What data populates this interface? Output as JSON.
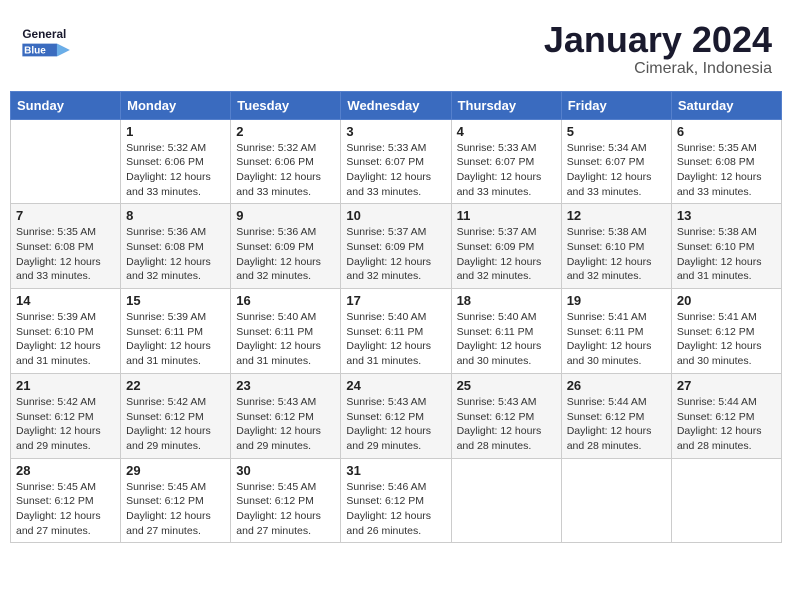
{
  "header": {
    "logo_line1": "General",
    "logo_line2": "Blue",
    "month": "January 2024",
    "location": "Cimerak, Indonesia"
  },
  "weekdays": [
    "Sunday",
    "Monday",
    "Tuesday",
    "Wednesday",
    "Thursday",
    "Friday",
    "Saturday"
  ],
  "weeks": [
    [
      {
        "day": "",
        "info": ""
      },
      {
        "day": "1",
        "info": "Sunrise: 5:32 AM\nSunset: 6:06 PM\nDaylight: 12 hours\nand 33 minutes."
      },
      {
        "day": "2",
        "info": "Sunrise: 5:32 AM\nSunset: 6:06 PM\nDaylight: 12 hours\nand 33 minutes."
      },
      {
        "day": "3",
        "info": "Sunrise: 5:33 AM\nSunset: 6:07 PM\nDaylight: 12 hours\nand 33 minutes."
      },
      {
        "day": "4",
        "info": "Sunrise: 5:33 AM\nSunset: 6:07 PM\nDaylight: 12 hours\nand 33 minutes."
      },
      {
        "day": "5",
        "info": "Sunrise: 5:34 AM\nSunset: 6:07 PM\nDaylight: 12 hours\nand 33 minutes."
      },
      {
        "day": "6",
        "info": "Sunrise: 5:35 AM\nSunset: 6:08 PM\nDaylight: 12 hours\nand 33 minutes."
      }
    ],
    [
      {
        "day": "7",
        "info": "Sunrise: 5:35 AM\nSunset: 6:08 PM\nDaylight: 12 hours\nand 33 minutes."
      },
      {
        "day": "8",
        "info": "Sunrise: 5:36 AM\nSunset: 6:08 PM\nDaylight: 12 hours\nand 32 minutes."
      },
      {
        "day": "9",
        "info": "Sunrise: 5:36 AM\nSunset: 6:09 PM\nDaylight: 12 hours\nand 32 minutes."
      },
      {
        "day": "10",
        "info": "Sunrise: 5:37 AM\nSunset: 6:09 PM\nDaylight: 12 hours\nand 32 minutes."
      },
      {
        "day": "11",
        "info": "Sunrise: 5:37 AM\nSunset: 6:09 PM\nDaylight: 12 hours\nand 32 minutes."
      },
      {
        "day": "12",
        "info": "Sunrise: 5:38 AM\nSunset: 6:10 PM\nDaylight: 12 hours\nand 32 minutes."
      },
      {
        "day": "13",
        "info": "Sunrise: 5:38 AM\nSunset: 6:10 PM\nDaylight: 12 hours\nand 31 minutes."
      }
    ],
    [
      {
        "day": "14",
        "info": "Sunrise: 5:39 AM\nSunset: 6:10 PM\nDaylight: 12 hours\nand 31 minutes."
      },
      {
        "day": "15",
        "info": "Sunrise: 5:39 AM\nSunset: 6:11 PM\nDaylight: 12 hours\nand 31 minutes."
      },
      {
        "day": "16",
        "info": "Sunrise: 5:40 AM\nSunset: 6:11 PM\nDaylight: 12 hours\nand 31 minutes."
      },
      {
        "day": "17",
        "info": "Sunrise: 5:40 AM\nSunset: 6:11 PM\nDaylight: 12 hours\nand 31 minutes."
      },
      {
        "day": "18",
        "info": "Sunrise: 5:40 AM\nSunset: 6:11 PM\nDaylight: 12 hours\nand 30 minutes."
      },
      {
        "day": "19",
        "info": "Sunrise: 5:41 AM\nSunset: 6:11 PM\nDaylight: 12 hours\nand 30 minutes."
      },
      {
        "day": "20",
        "info": "Sunrise: 5:41 AM\nSunset: 6:12 PM\nDaylight: 12 hours\nand 30 minutes."
      }
    ],
    [
      {
        "day": "21",
        "info": "Sunrise: 5:42 AM\nSunset: 6:12 PM\nDaylight: 12 hours\nand 29 minutes."
      },
      {
        "day": "22",
        "info": "Sunrise: 5:42 AM\nSunset: 6:12 PM\nDaylight: 12 hours\nand 29 minutes."
      },
      {
        "day": "23",
        "info": "Sunrise: 5:43 AM\nSunset: 6:12 PM\nDaylight: 12 hours\nand 29 minutes."
      },
      {
        "day": "24",
        "info": "Sunrise: 5:43 AM\nSunset: 6:12 PM\nDaylight: 12 hours\nand 29 minutes."
      },
      {
        "day": "25",
        "info": "Sunrise: 5:43 AM\nSunset: 6:12 PM\nDaylight: 12 hours\nand 28 minutes."
      },
      {
        "day": "26",
        "info": "Sunrise: 5:44 AM\nSunset: 6:12 PM\nDaylight: 12 hours\nand 28 minutes."
      },
      {
        "day": "27",
        "info": "Sunrise: 5:44 AM\nSunset: 6:12 PM\nDaylight: 12 hours\nand 28 minutes."
      }
    ],
    [
      {
        "day": "28",
        "info": "Sunrise: 5:45 AM\nSunset: 6:12 PM\nDaylight: 12 hours\nand 27 minutes."
      },
      {
        "day": "29",
        "info": "Sunrise: 5:45 AM\nSunset: 6:12 PM\nDaylight: 12 hours\nand 27 minutes."
      },
      {
        "day": "30",
        "info": "Sunrise: 5:45 AM\nSunset: 6:12 PM\nDaylight: 12 hours\nand 27 minutes."
      },
      {
        "day": "31",
        "info": "Sunrise: 5:46 AM\nSunset: 6:12 PM\nDaylight: 12 hours\nand 26 minutes."
      },
      {
        "day": "",
        "info": ""
      },
      {
        "day": "",
        "info": ""
      },
      {
        "day": "",
        "info": ""
      }
    ]
  ]
}
